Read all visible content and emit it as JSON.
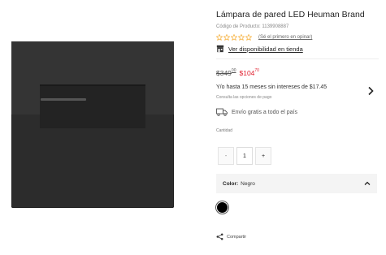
{
  "product": {
    "title": "Lámpara de pared LED Heuman Brand",
    "code_label": "Código de Producto: 1139908887",
    "rating": {
      "stars": 0,
      "max": 5,
      "review_link": "(Sé el primero en opinar)"
    },
    "availability_link": "Ver disponibilidad en tienda"
  },
  "pricing": {
    "old_price_main": "$349",
    "old_price_cents": "00",
    "new_price_main": "$104",
    "new_price_cents": "70",
    "installments": "Y/o hasta 15 meses sin intereses de $17.45",
    "payment_options": "Consulta las opciones de pago"
  },
  "shipping": {
    "text": "Envío gratis a todo el país"
  },
  "quantity": {
    "label": "Cantidad",
    "value": "1",
    "minus": "-",
    "plus": "+"
  },
  "color": {
    "label": "Color:",
    "value": "Negro",
    "swatches": [
      "#000000"
    ]
  },
  "share": {
    "label": "Compartir"
  },
  "colors": {
    "sale_red": "#e0202f",
    "star_orange": "#f5a623",
    "bar_bg": "#f4f4f4"
  },
  "icons": {
    "star": "star-outline-icon",
    "store": "store-icon",
    "chevron_right": "chevron-right-icon",
    "truck": "truck-icon",
    "chevron_up": "chevron-up-icon",
    "share": "share-icon"
  }
}
